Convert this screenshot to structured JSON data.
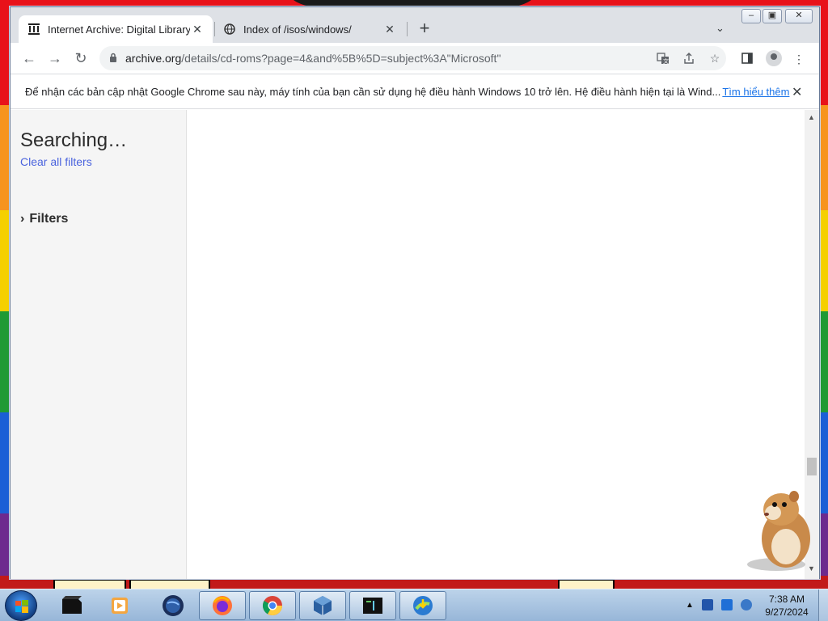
{
  "browser": {
    "tabs": [
      {
        "title": "Internet Archive: Digital Library o",
        "favicon": "archive-icon",
        "active": true
      },
      {
        "title": "Index of /isos/windows/",
        "favicon": "globe-icon",
        "active": false
      }
    ],
    "new_tab_label": "+",
    "url_host": "archive.org",
    "url_path": "/details/cd-roms?page=4&and%5B%5D=subject%3A\"Microsoft\""
  },
  "infobar": {
    "message": "Để nhận các bản cập nhật Google Chrome sau này, máy tính của bạn cần sử dụng hệ điều hành Windows 10 trở lên. Hệ điều hành hiện tại là Wind...",
    "link": "Tìm hiểu thêm"
  },
  "page": {
    "heading": "Searching…",
    "clear_filters": "Clear all filters",
    "filters_label": "Filters"
  },
  "taskbar": {
    "apps": [
      "media-player-icon",
      "vlc-icon",
      "globe-app-icon",
      "firefox-icon",
      "chrome-icon",
      "virtualbox-icon",
      "terminal-icon",
      "idm-icon"
    ],
    "time": "7:38 AM",
    "date": "9/27/2024"
  },
  "colors": {
    "accent_link": "#4b64de",
    "chrome_link": "#1a73e8"
  }
}
